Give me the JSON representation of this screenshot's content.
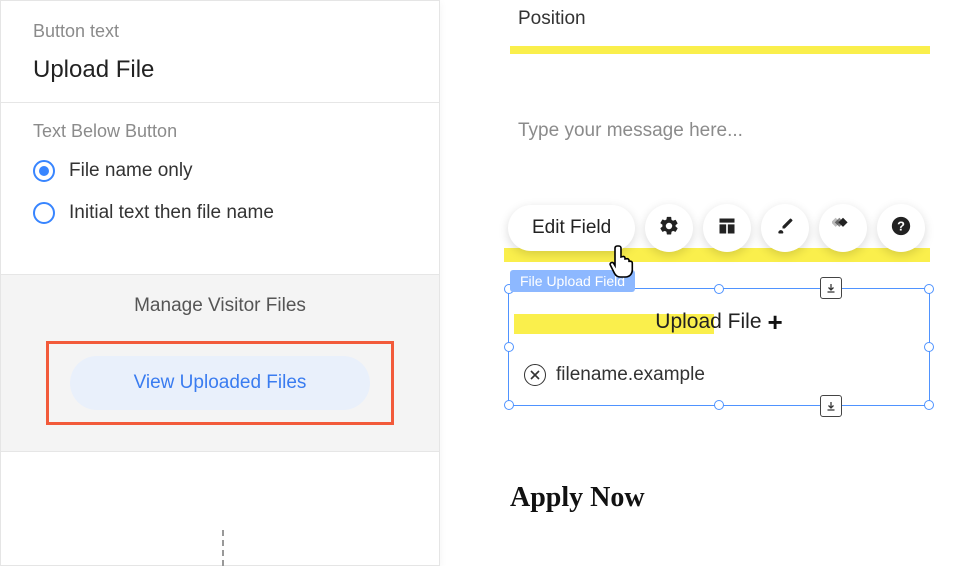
{
  "left": {
    "button_text_label": "Button text",
    "button_text_value": "Upload File",
    "text_below_button_label": "Text Below Button",
    "radio_options": [
      {
        "label": "File name only",
        "selected": true
      },
      {
        "label": "Initial text then file name",
        "selected": false
      }
    ],
    "manage_visitor_files_title": "Manage Visitor Files",
    "view_uploaded_files_label": "View Uploaded Files"
  },
  "canvas": {
    "position_label": "Position",
    "message_placeholder": "Type your message here...",
    "toolbar": {
      "edit_field_label": "Edit Field"
    },
    "field_badge": "File Upload Field",
    "upload_button_label": "Upload File",
    "filename_example": "filename.example",
    "apply_now_label": "Apply Now"
  }
}
